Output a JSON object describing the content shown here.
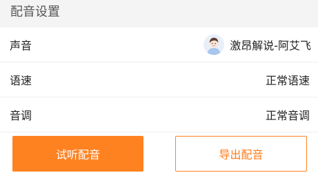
{
  "header": {
    "title": "配音设置"
  },
  "settings": {
    "voice": {
      "label": "声音",
      "value": "激昂解说-阿艾飞",
      "avatar_icon": "user-avatar-icon"
    },
    "speed": {
      "label": "语速",
      "value": "正常语速"
    },
    "pitch": {
      "label": "音调",
      "value": "正常音调"
    }
  },
  "actions": {
    "preview_label": "试听配音",
    "export_label": "导出配音"
  },
  "colors": {
    "accent": "#ff8221",
    "background": "#f4f4f4",
    "card": "#ffffff",
    "text": "#222222",
    "header_text": "#555555"
  }
}
